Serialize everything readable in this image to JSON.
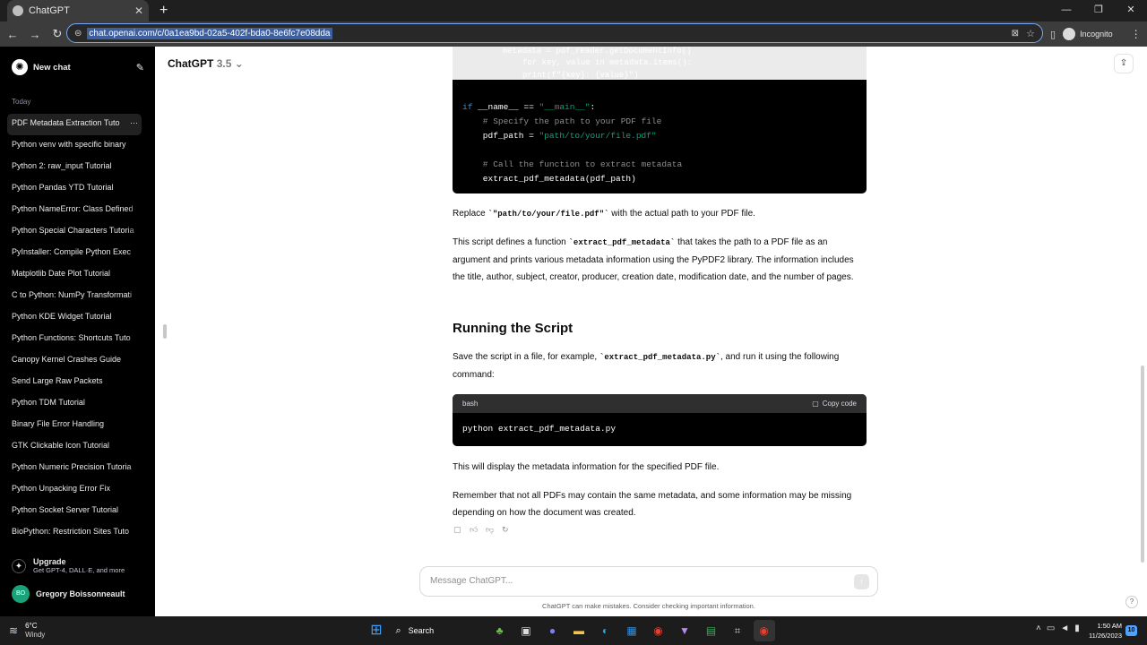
{
  "browser": {
    "tab_title": "ChatGPT",
    "url": "chat.openai.com/c/0a1ea9bd-02a5-402f-bda0-8e6fc7e08dda",
    "profile": "Incognito"
  },
  "sidebar": {
    "new_chat": "New chat",
    "section": "Today",
    "items": [
      "PDF Metadata Extraction Tuto",
      "Python venv with specific binary",
      "Python 2: raw_input Tutorial",
      "Python Pandas YTD Tutorial",
      "Python NameError: Class Defined",
      "Python Special Characters Tutoria",
      "PyInstaller: Compile Python Exec",
      "Matplotlib Date Plot Tutorial",
      "C to Python: NumPy Transformati",
      "Python KDE Widget Tutorial",
      "Python Functions: Shortcuts Tuto",
      "Canopy Kernel Crashes Guide",
      "Send Large Raw Packets",
      "Python TDM Tutorial",
      "Binary File Error Handling",
      "GTK Clickable Icon Tutorial",
      "Python Numeric Precision Tutoria",
      "Python Unpacking Error Fix",
      "Python Socket Server Tutorial",
      "BioPython: Restriction Sites Tuto"
    ],
    "upgrade_title": "Upgrade",
    "upgrade_sub": "Get GPT-4, DALL·E, and more",
    "user_initials": "BO",
    "user_name": "Gregory Boissonneault"
  },
  "header": {
    "model": "ChatGPT",
    "version": "3.5"
  },
  "code_top": {
    "faded1": "metadata = pdf_reader.getDocumentInfo()",
    "faded2": "for key, value in metadata.items():",
    "faded3": "print(f\"{key}: {value}\")",
    "l1_kw": "if",
    "l1_a": " __name__ == ",
    "l1_str": "\"__main__\"",
    "l1_b": ":",
    "l2": "    # Specify the path to your PDF file",
    "l3_a": "    pdf_path = ",
    "l3_str": "\"path/to/your/file.pdf\"",
    "l4": "    # Call the function to extract metadata",
    "l5": "    extract_pdf_metadata(pdf_path)"
  },
  "message": {
    "p1_a": "Replace ",
    "p1_code": "`\"path/to/your/file.pdf\"`",
    "p1_b": " with the actual path to your PDF file.",
    "p2_a": "This script defines a function ",
    "p2_code": "`extract_pdf_metadata`",
    "p2_b": " that takes the path to a PDF file as an argument and prints various metadata information using the PyPDF2 library. The information includes the title, author, subject, creator, producer, creation date, modification date, and the number of pages.",
    "heading": "Running the Script",
    "p3_a": "Save the script in a file, for example, ",
    "p3_code": "`extract_pdf_metadata.py`",
    "p3_b": ", and run it using the following command:",
    "bash_lang": "bash",
    "copy_label": "Copy code",
    "bash_code": "python extract_pdf_metadata.py",
    "p4": "This will display the metadata information for the specified PDF file.",
    "p5": "Remember that not all PDFs may contain the same metadata, and some information may be missing depending on how the document was created."
  },
  "composer": {
    "placeholder": "Message ChatGPT...",
    "disclaimer": "ChatGPT can make mistakes. Consider checking important information."
  },
  "taskbar": {
    "temp": "6°C",
    "weather": "Windy",
    "search": "Search",
    "time": "1:50 AM",
    "date": "11/26/2023",
    "notifications": "10"
  }
}
